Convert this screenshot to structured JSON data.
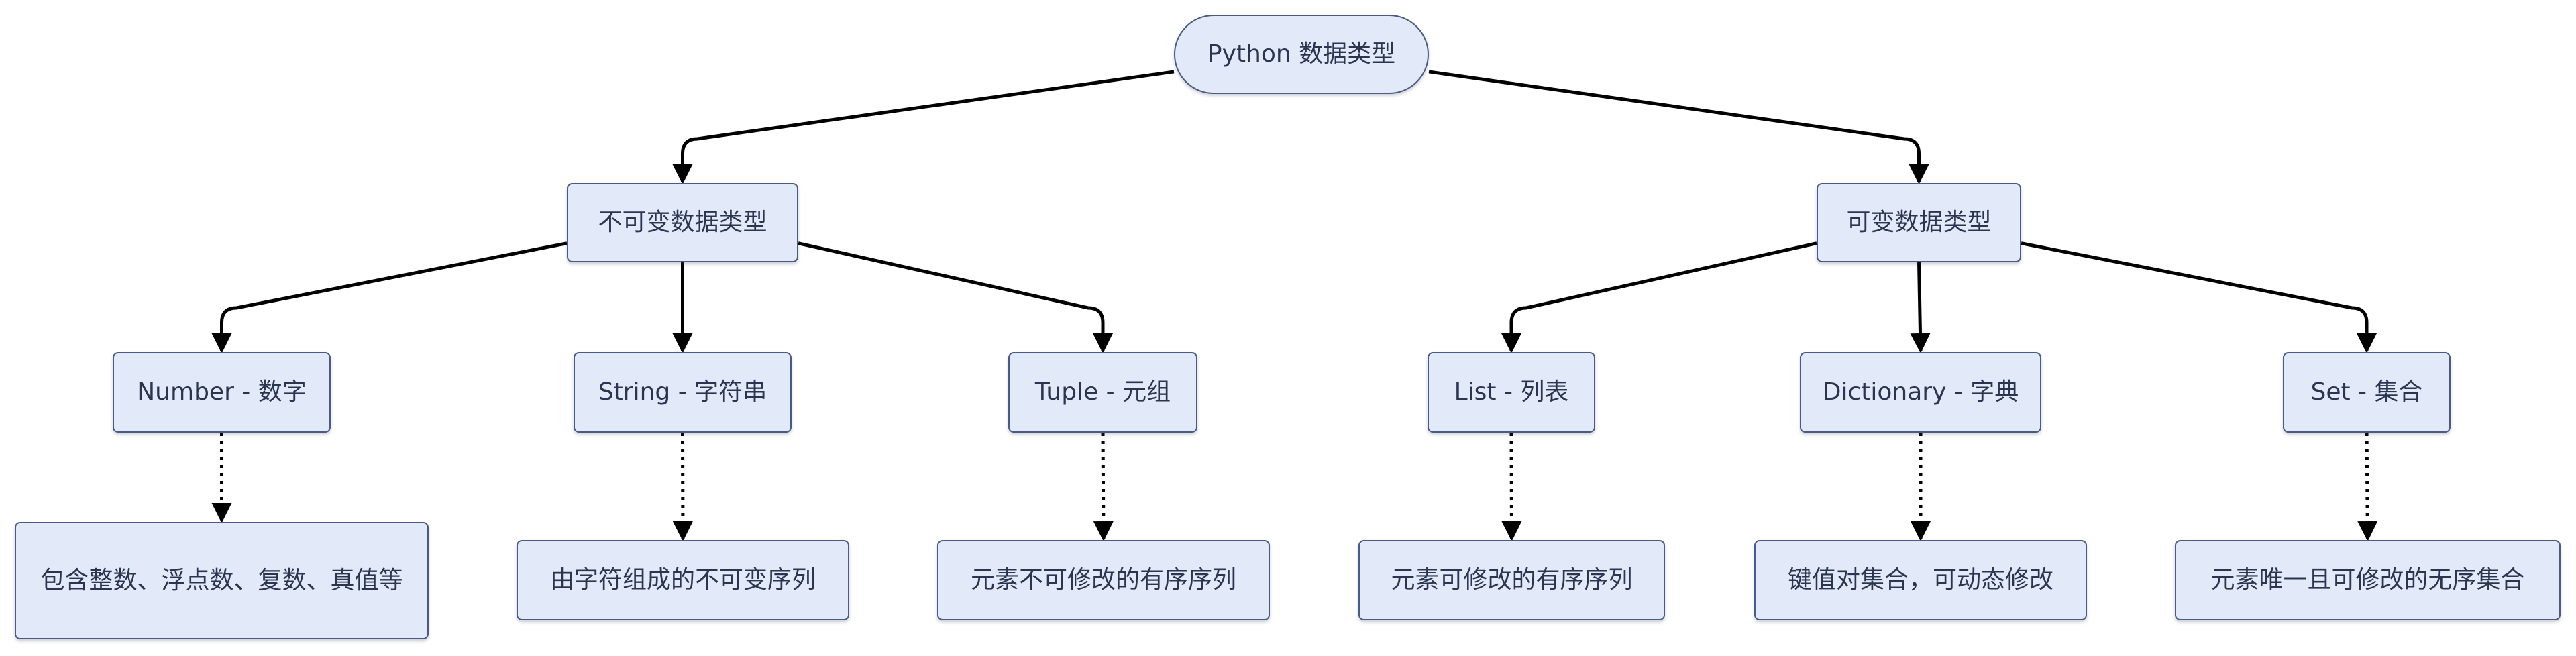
{
  "colors": {
    "node_fill": "#e2eaf9",
    "node_border": "#4a5a82",
    "text": "#2b3550",
    "edge": "#000000"
  },
  "nodes": {
    "root": "Python 数据类型",
    "immutable": "不可变数据类型",
    "mutable": "可变数据类型",
    "number": "Number - 数字",
    "string": "String - 字符串",
    "tuple": "Tuple - 元组",
    "list": "List - 列表",
    "dictionary": "Dictionary - 字典",
    "set": "Set - 集合",
    "number_desc": "包含整数、浮点数、复数、真值等",
    "string_desc": "由字符组成的不可变序列",
    "tuple_desc": "元素不可修改的有序序列",
    "list_desc": "元素可修改的有序序列",
    "dictionary_desc": "键值对集合，可动态修改",
    "set_desc": "元素唯一且可修改的无序集合"
  },
  "edges": [
    {
      "from": "root",
      "to": "immutable",
      "style": "solid"
    },
    {
      "from": "root",
      "to": "mutable",
      "style": "solid"
    },
    {
      "from": "immutable",
      "to": "number",
      "style": "solid"
    },
    {
      "from": "immutable",
      "to": "string",
      "style": "solid"
    },
    {
      "from": "immutable",
      "to": "tuple",
      "style": "solid"
    },
    {
      "from": "mutable",
      "to": "list",
      "style": "solid"
    },
    {
      "from": "mutable",
      "to": "dictionary",
      "style": "solid"
    },
    {
      "from": "mutable",
      "to": "set",
      "style": "solid"
    },
    {
      "from": "number",
      "to": "number_desc",
      "style": "dotted"
    },
    {
      "from": "string",
      "to": "string_desc",
      "style": "dotted"
    },
    {
      "from": "tuple",
      "to": "tuple_desc",
      "style": "dotted"
    },
    {
      "from": "list",
      "to": "list_desc",
      "style": "dotted"
    },
    {
      "from": "dictionary",
      "to": "dictionary_desc",
      "style": "dotted"
    },
    {
      "from": "set",
      "to": "set_desc",
      "style": "dotted"
    }
  ]
}
